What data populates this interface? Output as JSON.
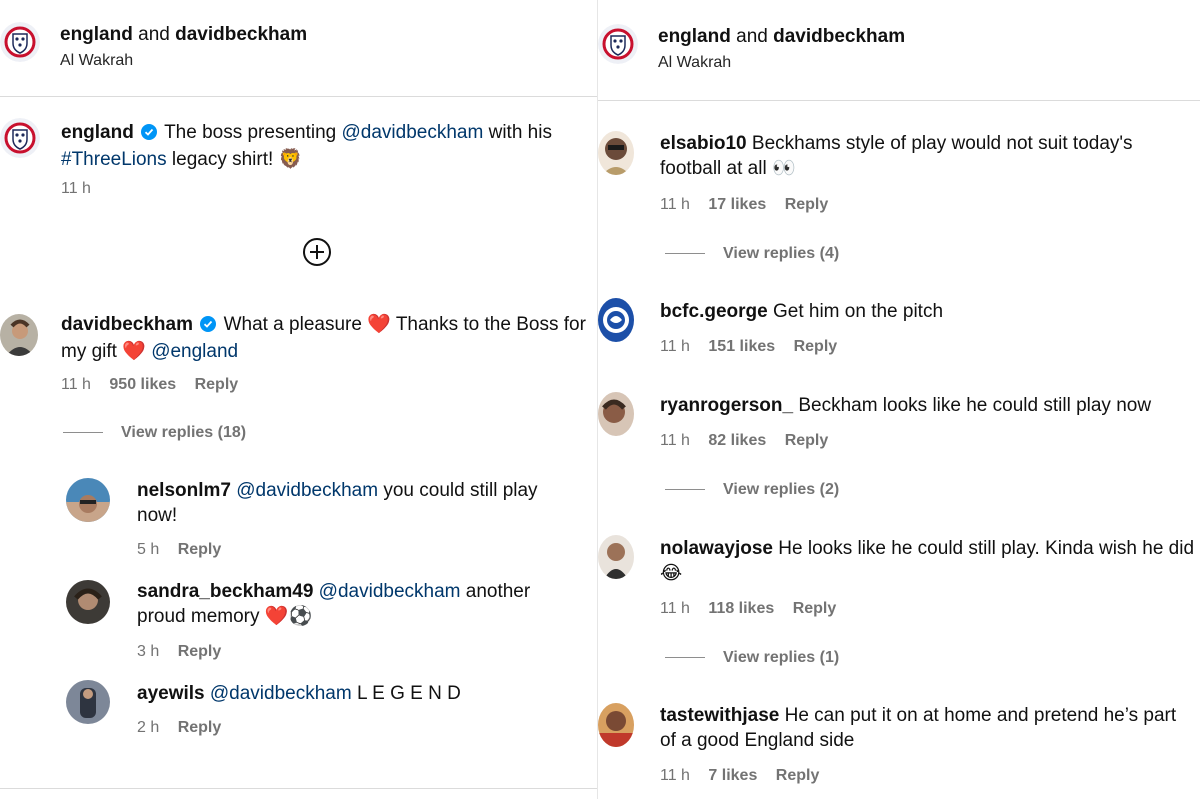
{
  "left": {
    "header": {
      "name1": "england",
      "and": "and",
      "name2": "davidbeckham",
      "location": "Al Wakrah"
    },
    "caption": {
      "user": "england",
      "pre": "The boss presenting",
      "mention": "@davidbeckham",
      "mid": "with his",
      "hashtag": "#ThreeLions",
      "post": "legacy shirt!",
      "emoji": "🦁",
      "time": "11 h"
    },
    "comments": [
      {
        "user": "davidbeckham",
        "text1": "What a pleasure",
        "emoji1": "❤️",
        "text2": "Thanks to the Boss for my gift",
        "emoji2": "❤️",
        "mention": "@england",
        "time": "11 h",
        "likes": "950 likes",
        "reply": "Reply",
        "view_replies": "View replies (18)"
      }
    ],
    "replies": [
      {
        "user": "nelsonlm7",
        "mention": "@davidbeckham",
        "text": "you could still play now!",
        "time": "5 h",
        "reply": "Reply"
      },
      {
        "user": "sandra_beckham49",
        "mention": "@davidbeckham",
        "text": "another proud memory",
        "emoji": "❤️⚽",
        "time": "3 h",
        "reply": "Reply"
      },
      {
        "user": "ayewils",
        "mention": "@davidbeckham",
        "text": "L E G E N D",
        "time": "2 h",
        "reply": "Reply"
      }
    ],
    "icons": {
      "load_more": "plus-circle-icon",
      "verified": "verified-badge-icon"
    }
  },
  "right": {
    "header": {
      "name1": "england",
      "and": "and",
      "name2": "davidbeckham",
      "location": "Al Wakrah"
    },
    "comments": [
      {
        "user": "elsabio10",
        "text": "Beckhams style of play would not suit today's football at all",
        "emoji": "👀",
        "time": "11 h",
        "likes": "17 likes",
        "reply": "Reply",
        "view_replies": "View replies (4)"
      },
      {
        "user": "bcfc.george",
        "text": "Get him on the pitch",
        "time": "11 h",
        "likes": "151 likes",
        "reply": "Reply"
      },
      {
        "user": "ryanrogerson_",
        "text": "Beckham looks like he could still play now",
        "time": "11 h",
        "likes": "82 likes",
        "reply": "Reply",
        "view_replies": "View replies (2)"
      },
      {
        "user": "nolawayjose",
        "text": "He looks like he could still play. Kinda wish he did",
        "emoji": "😂",
        "time": "11 h",
        "likes": "118 likes",
        "reply": "Reply",
        "view_replies": "View replies (1)"
      },
      {
        "user": "tastewithjase",
        "text": "He can put it on at home and pretend he’s part of a good England side",
        "time": "11 h",
        "likes": "7 likes",
        "reply": "Reply"
      }
    ]
  },
  "colors": {
    "mention": "#00376b",
    "meta": "#737373",
    "verified": "#0095f6",
    "divider": "#dbdbdb",
    "heart": "#e0245e"
  }
}
